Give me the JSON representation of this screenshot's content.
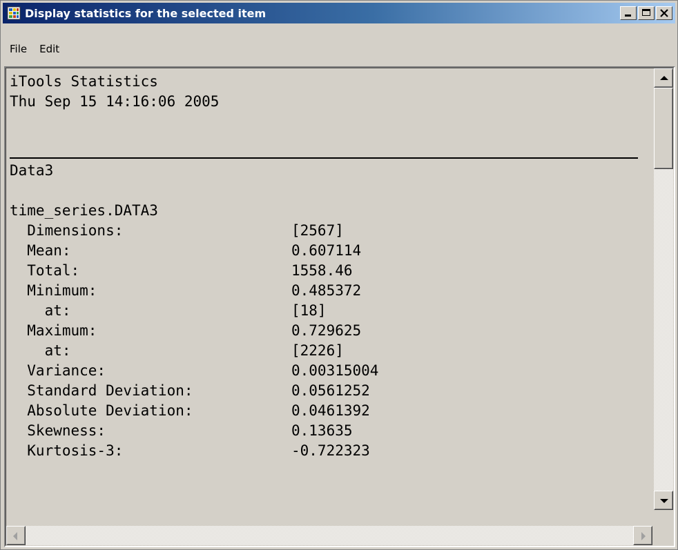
{
  "window": {
    "title": "Display statistics for the selected item",
    "icon": "app-icon"
  },
  "menu": {
    "file": "File",
    "edit": "Edit"
  },
  "report": {
    "heading": "iTools Statistics",
    "timestamp": "Thu Sep 15 14:16:06 2005",
    "item_name": "Data3",
    "series_name": "time_series.DATA3",
    "stats": [
      {
        "label": "  Dimensions:",
        "value": "[2567]"
      },
      {
        "label": "  Mean:",
        "value": "0.607114"
      },
      {
        "label": "  Total:",
        "value": "1558.46"
      },
      {
        "label": "  Minimum:",
        "value": "0.485372"
      },
      {
        "label": "    at:",
        "value": "[18]"
      },
      {
        "label": "  Maximum:",
        "value": "0.729625"
      },
      {
        "label": "    at:",
        "value": "[2226]"
      },
      {
        "label": "  Variance:",
        "value": "0.00315004"
      },
      {
        "label": "  Standard Deviation:",
        "value": "0.0561252"
      },
      {
        "label": "  Absolute Deviation:",
        "value": "0.0461392"
      },
      {
        "label": "  Skewness:",
        "value": "0.13635"
      },
      {
        "label": "  Kurtosis-3:",
        "value": "-0.722323"
      }
    ]
  }
}
